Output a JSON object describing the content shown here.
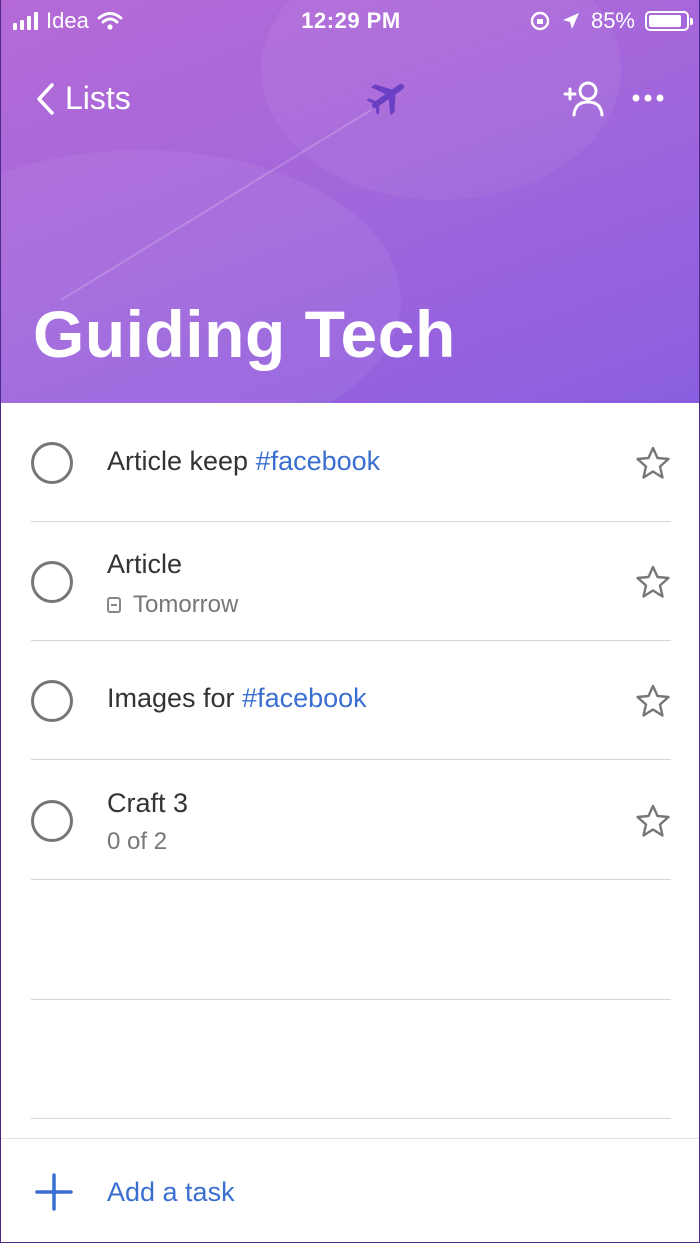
{
  "status_bar": {
    "carrier": "Idea",
    "time": "12:29 PM",
    "battery_percent": "85%",
    "battery_level": 0.85
  },
  "header": {
    "back_label": "Lists",
    "title": "Guiding Tech",
    "icons": [
      "chevron-left-icon",
      "airplane-icon",
      "add-person-icon",
      "more-icon"
    ],
    "gradient_colors": [
      "#b56ad6",
      "#8a5ee0"
    ]
  },
  "tasks": [
    {
      "text": "Article keep ",
      "tag": "#facebook",
      "sub": ""
    },
    {
      "text": "Article",
      "tag": "",
      "sub": "Tomorrow",
      "sub_icon": "calendar-icon"
    },
    {
      "text": "Images for ",
      "tag": "#facebook",
      "sub": ""
    },
    {
      "text": "Craft 3",
      "tag": "",
      "sub": "0 of 2"
    }
  ],
  "add_task": {
    "label": "Add a task",
    "icon": "plus-icon"
  },
  "colors": {
    "accent": "#3a6fd1",
    "text": "#333333",
    "muted": "#777777"
  }
}
